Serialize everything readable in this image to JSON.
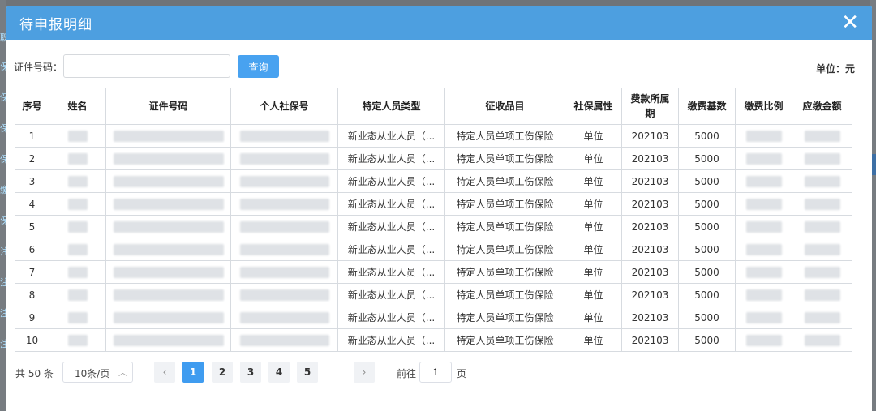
{
  "dialog": {
    "title": "待申报明细",
    "close_icon": "close-icon"
  },
  "search": {
    "label": "证件号码：",
    "value": "",
    "placeholder": "",
    "button_label": "查询"
  },
  "unit_label": "单位：元",
  "table": {
    "columns": [
      "序号",
      "姓名",
      "证件号码",
      "个人社保号",
      "特定人员类型",
      "征收品目",
      "社保属性",
      "费款所属期",
      "缴费基数",
      "缴费比例",
      "应缴金额"
    ],
    "rows": [
      {
        "no": "1",
        "type": "新业态从业人员（...",
        "item": "特定人员单项工伤保险",
        "attr": "单位",
        "period": "202103",
        "base": "5000"
      },
      {
        "no": "2",
        "type": "新业态从业人员（...",
        "item": "特定人员单项工伤保险",
        "attr": "单位",
        "period": "202103",
        "base": "5000"
      },
      {
        "no": "3",
        "type": "新业态从业人员（...",
        "item": "特定人员单项工伤保险",
        "attr": "单位",
        "period": "202103",
        "base": "5000"
      },
      {
        "no": "4",
        "type": "新业态从业人员（...",
        "item": "特定人员单项工伤保险",
        "attr": "单位",
        "period": "202103",
        "base": "5000"
      },
      {
        "no": "5",
        "type": "新业态从业人员（...",
        "item": "特定人员单项工伤保险",
        "attr": "单位",
        "period": "202103",
        "base": "5000"
      },
      {
        "no": "6",
        "type": "新业态从业人员（...",
        "item": "特定人员单项工伤保险",
        "attr": "单位",
        "period": "202103",
        "base": "5000"
      },
      {
        "no": "7",
        "type": "新业态从业人员（...",
        "item": "特定人员单项工伤保险",
        "attr": "单位",
        "period": "202103",
        "base": "5000"
      },
      {
        "no": "8",
        "type": "新业态从业人员（...",
        "item": "特定人员单项工伤保险",
        "attr": "单位",
        "period": "202103",
        "base": "5000"
      },
      {
        "no": "9",
        "type": "新业态从业人员（...",
        "item": "特定人员单项工伤保险",
        "attr": "单位",
        "period": "202103",
        "base": "5000"
      },
      {
        "no": "10",
        "type": "新业态从业人员（...",
        "item": "特定人员单项工伤保险",
        "attr": "单位",
        "period": "202103",
        "base": "5000"
      }
    ]
  },
  "pagination": {
    "total": "共 50 条",
    "page_size": "10条/页",
    "pages": [
      "1",
      "2",
      "3",
      "4",
      "5"
    ],
    "current_page": "1",
    "prev_icon": "chevron-left-icon",
    "next_icon": "chevron-right-icon",
    "goto_label": "前往",
    "goto_value": "1",
    "goto_suffix": "页"
  },
  "colors": {
    "header": "#4d9fe0",
    "primary_button": "#48a2f0",
    "active_page": "#3f9cf0"
  }
}
